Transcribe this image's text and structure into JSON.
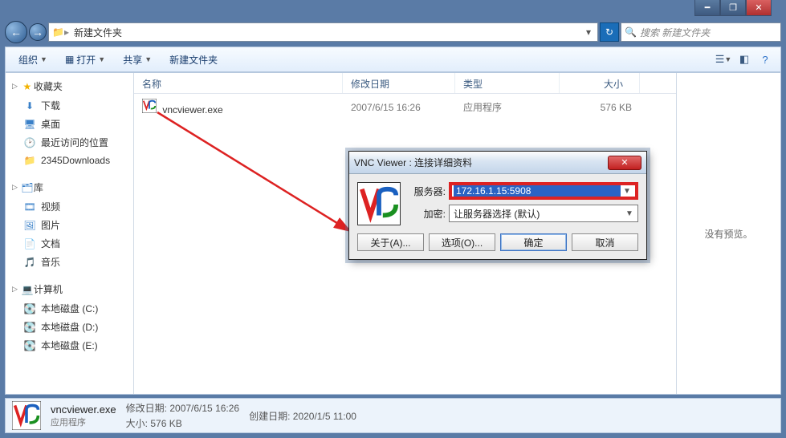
{
  "address": {
    "folder": "新建文件夹"
  },
  "search": {
    "placeholder": "搜索 新建文件夹"
  },
  "toolbar": {
    "organize": "组织",
    "open": "打开",
    "share": "共享",
    "newfolder": "新建文件夹"
  },
  "columns": {
    "name": "名称",
    "date": "修改日期",
    "type": "类型",
    "size": "大小"
  },
  "sidebar": {
    "favorites": "收藏夹",
    "fav_items": [
      "下载",
      "桌面",
      "最近访问的位置",
      "2345Downloads"
    ],
    "libraries": "库",
    "lib_items": [
      "视频",
      "图片",
      "文档",
      "音乐"
    ],
    "computer": "计算机",
    "drives": [
      "本地磁盘 (C:)",
      "本地磁盘 (D:)",
      "本地磁盘 (E:)"
    ]
  },
  "file": {
    "name": "vncviewer.exe",
    "date": "2007/6/15 16:26",
    "type": "应用程序",
    "size": "576 KB"
  },
  "preview": {
    "empty": "没有预览。"
  },
  "status": {
    "name": "vncviewer.exe",
    "type": "应用程序",
    "mod_label": "修改日期:",
    "mod_val": "2007/6/15 16:26",
    "size_label": "大小:",
    "size_val": "576 KB",
    "create_label": "创建日期:",
    "create_val": "2020/1/5 11:00"
  },
  "dialog": {
    "title": "VNC Viewer : 连接详细资料",
    "server_label": "服务器:",
    "server_value": "172.16.1.15:5908",
    "encrypt_label": "加密:",
    "encrypt_value": "让服务器选择 (默认)",
    "about": "关于(A)...",
    "options": "选项(O)...",
    "ok": "确定",
    "cancel": "取消"
  }
}
